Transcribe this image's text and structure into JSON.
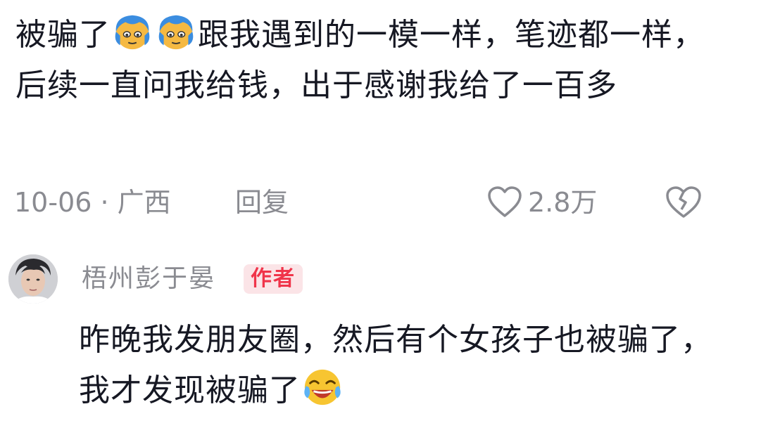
{
  "comment": {
    "text_part1": "被骗了",
    "emoji_1": "blue-hair-face-emoji",
    "emoji_2": "blue-hair-face-emoji",
    "text_part2": "跟我遇到的一模一样，笔迹都一样，后续一直问我给钱，出于感谢我给了一百多",
    "date_location": "10-06 · 广西",
    "reply_label": "回复",
    "like_icon": "heart-outline-icon",
    "like_count": "2.8万",
    "dislike_icon": "broken-heart-icon"
  },
  "reply": {
    "avatar_icon": "user-avatar",
    "author_name": "梧州彭于晏",
    "author_badge": "作者",
    "text": "昨晚我发朋友圈，然后有个女孩子也被骗了，我才发现被骗了",
    "emoji": "laughing-crying-emoji"
  },
  "colors": {
    "text_primary": "#161823",
    "text_secondary": "#8a8b91",
    "badge_text": "#f0344a",
    "badge_bg": "#fbe4e7"
  }
}
